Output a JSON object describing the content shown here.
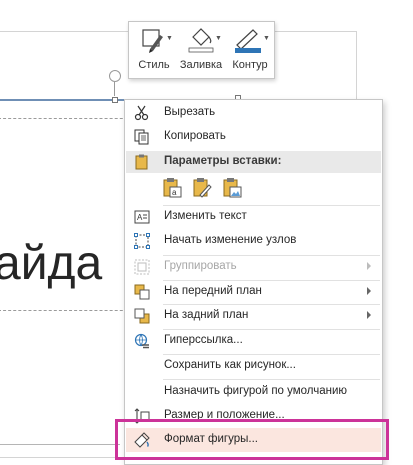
{
  "slide": {
    "text": "айда"
  },
  "mini_toolbar": {
    "style_label": "Стиль",
    "fill_label": "Заливка",
    "outline_label": "Контур"
  },
  "context_menu": {
    "items": [
      {
        "label": "Вырезать",
        "icon": "scissors-icon",
        "enabled": true
      },
      {
        "label": "Копировать",
        "icon": "copy-icon",
        "enabled": true
      },
      {
        "label": "Параметры вставки:",
        "icon": "paste-icon",
        "enabled": true
      },
      {
        "label": "Изменить текст",
        "icon": "edit-text-icon",
        "enabled": true
      },
      {
        "label": "Начать изменение узлов",
        "icon": "edit-points-icon",
        "enabled": true
      },
      {
        "label": "Группировать",
        "icon": "group-icon",
        "enabled": false
      },
      {
        "label": "На передний план",
        "icon": "bring-forward-icon",
        "enabled": true
      },
      {
        "label": "На задний план",
        "icon": "send-backward-icon",
        "enabled": true
      },
      {
        "label": "Гиперссылка...",
        "icon": "hyperlink-icon",
        "enabled": true
      },
      {
        "label": "Сохранить как рисунок...",
        "icon": "",
        "enabled": true
      },
      {
        "label": "Назначить фигурой по умолчанию",
        "icon": "",
        "enabled": true
      },
      {
        "label": "Размер и положение...",
        "icon": "size-position-icon",
        "enabled": true
      },
      {
        "label": "Формат фигуры...",
        "icon": "format-shape-icon",
        "enabled": true
      }
    ]
  },
  "colors": {
    "highlight_frame": "#cc3399",
    "hover_background": "#fbe6df",
    "accent_blue": "#2e75b6"
  }
}
